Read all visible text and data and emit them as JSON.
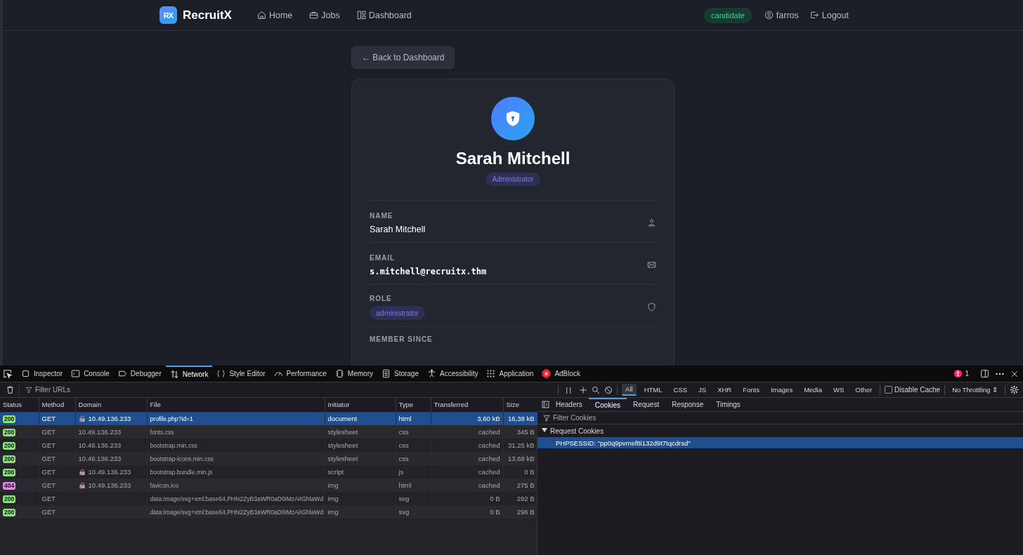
{
  "navbar": {
    "logo_badge": "RX",
    "brand": "RecruitX",
    "links": [
      {
        "label": "Home"
      },
      {
        "label": "Jobs"
      },
      {
        "label": "Dashboard"
      }
    ],
    "role_badge": "candidate",
    "user": "farros",
    "logout": "Logout"
  },
  "back_button": "← Back to Dashboard",
  "profile": {
    "name": "Sarah Mitchell",
    "role_badge": "Administrator",
    "fields": [
      {
        "kind": "text",
        "label": "NAME",
        "value": "Sarah Mitchell"
      },
      {
        "kind": "mono",
        "label": "EMAIL",
        "value": "s.mitchell@recruitx.thm"
      },
      {
        "kind": "badge",
        "label": "ROLE",
        "value": "administrator"
      },
      {
        "kind": "cut",
        "label": "MEMBER SINCE"
      }
    ]
  },
  "devtools": {
    "tabs": [
      {
        "label": "Inspector",
        "selected": false
      },
      {
        "label": "Console",
        "selected": false
      },
      {
        "label": "Debugger",
        "selected": false
      },
      {
        "label": "Network",
        "selected": true
      },
      {
        "label": "Style Editor",
        "selected": false
      },
      {
        "label": "Performance",
        "selected": false
      },
      {
        "label": "Memory",
        "selected": false
      },
      {
        "label": "Storage",
        "selected": false
      },
      {
        "label": "Accessibility",
        "selected": false
      },
      {
        "label": "Application",
        "selected": false
      },
      {
        "label": "AdBlock",
        "selected": false
      }
    ],
    "error_count": "1",
    "filter_placeholder": "Filter URLs",
    "pause_label": "| |",
    "type_filters": [
      {
        "label": "All",
        "selected": true
      },
      {
        "label": "HTML",
        "selected": false
      },
      {
        "label": "CSS",
        "selected": false
      },
      {
        "label": "JS",
        "selected": false
      },
      {
        "label": "XHR",
        "selected": false
      },
      {
        "label": "Fonts",
        "selected": false
      },
      {
        "label": "Images",
        "selected": false
      },
      {
        "label": "Media",
        "selected": false
      },
      {
        "label": "WS",
        "selected": false
      },
      {
        "label": "Other",
        "selected": false
      }
    ],
    "disable_cache": {
      "label": "Disable Cache",
      "checked": false
    },
    "throttling": "No Throttling ⇕",
    "columns": [
      "Status",
      "Method",
      "Domain",
      "File",
      "Initiator",
      "Type",
      "Transferred",
      "Size"
    ],
    "rows": [
      {
        "status": "200",
        "color": "#8ae57a",
        "method": "GET",
        "insecure": true,
        "domain": "10.49.136.233",
        "file": "profile.php?id=1",
        "initiator": "document",
        "type": "html",
        "transferred": "3,60 kB",
        "size": "16,38 kB",
        "selected": true
      },
      {
        "status": "200",
        "color": "#8ae57a",
        "method": "GET",
        "insecure": false,
        "domain": "10.49.136.233",
        "file": "fonts.css",
        "initiator": "stylesheet",
        "type": "css",
        "transferred": "cached",
        "size": "345 B",
        "selected": false
      },
      {
        "status": "200",
        "color": "#8ae57a",
        "method": "GET",
        "insecure": false,
        "domain": "10.49.136.233",
        "file": "bootstrap.min.css",
        "initiator": "stylesheet",
        "type": "css",
        "transferred": "cached",
        "size": "31,25 kB",
        "selected": false
      },
      {
        "status": "200",
        "color": "#8ae57a",
        "method": "GET",
        "insecure": false,
        "domain": "10.49.136.233",
        "file": "bootstrap-icons.min.css",
        "initiator": "stylesheet",
        "type": "css",
        "transferred": "cached",
        "size": "13,68 kB",
        "selected": false
      },
      {
        "status": "200",
        "color": "#8ae57a",
        "method": "GET",
        "insecure": true,
        "domain": "10.49.136.233",
        "file": "bootstrap.bundle.min.js",
        "initiator": "script",
        "type": "js",
        "transferred": "cached",
        "size": "0 B",
        "selected": false
      },
      {
        "status": "404",
        "color": "#ee82ee",
        "method": "GET",
        "insecure": true,
        "domain": "10.49.136.233",
        "file": "favicon.ico",
        "initiator": "img",
        "type": "html",
        "transferred": "cached",
        "size": "275 B",
        "selected": false
      },
      {
        "status": "200",
        "color": "#8ae57a",
        "method": "GET",
        "insecure": false,
        "file": "data:image/svg+xml;base64,PHN2ZyB3aWR0aD0iMzAiIGhlaWd",
        "initiator": "img",
        "type": "svg",
        "transferred": "0 B",
        "size": "292 B",
        "selected": false
      },
      {
        "status": "200",
        "color": "#8ae57a",
        "method": "GET",
        "insecure": false,
        "file": "data:image/svg+xml;base64,PHN2ZyB3aWR0aD0iMzAiIGhlaWd",
        "initiator": "img",
        "type": "svg",
        "transferred": "0 B",
        "size": "296 B",
        "selected": false
      }
    ],
    "side_tabs": [
      {
        "label": "Headers",
        "selected": false
      },
      {
        "label": "Cookies",
        "selected": true
      },
      {
        "label": "Request",
        "selected": false
      },
      {
        "label": "Response",
        "selected": false
      },
      {
        "label": "Timings",
        "selected": false
      }
    ],
    "cookie_filter_placeholder": "Filter Cookies",
    "section": {
      "label": "Request Cookies",
      "expanded": true
    },
    "cookies": [
      {
        "text": "PHPSESSID: \"pp0q9pvmef8i132d9t7tqcdrsd\"",
        "selected": true
      }
    ]
  }
}
